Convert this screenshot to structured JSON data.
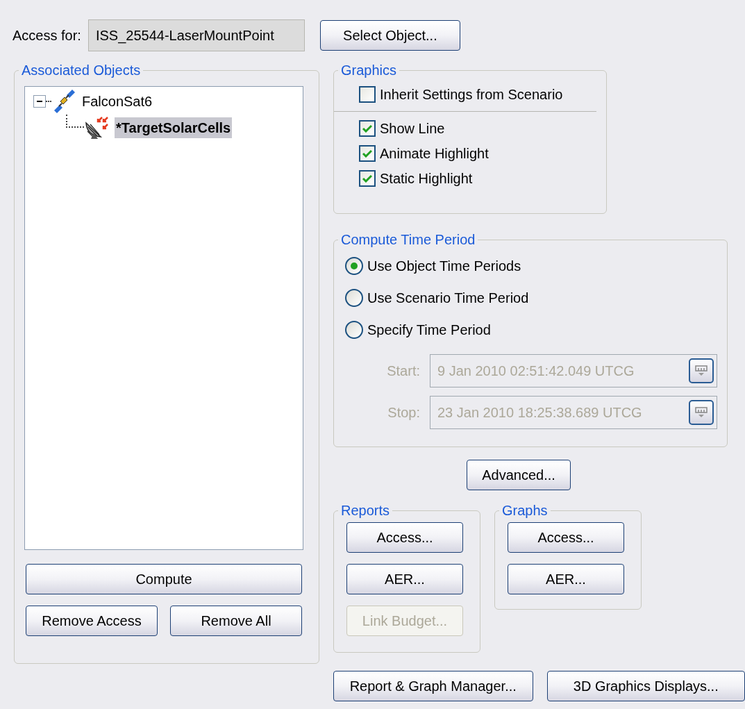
{
  "access_for": {
    "label": "Access for:",
    "value": "ISS_25544-LaserMountPoint"
  },
  "select_object_button": {
    "label": "Select Object...",
    "disabled": false
  },
  "associated_objects": {
    "title": "Associated Objects",
    "tree": [
      {
        "label": "FalconSat6",
        "kind": "satellite",
        "expanded": true,
        "selected": false,
        "children": [
          {
            "label": "*TargetSolarCells",
            "kind": "target",
            "selected": true
          }
        ]
      }
    ],
    "compute_button": {
      "label": "Compute",
      "disabled": false
    },
    "remove_buttons": [
      {
        "label": "Remove Access",
        "disabled": false
      },
      {
        "label": "Remove All",
        "disabled": false
      }
    ]
  },
  "graphics": {
    "title": "Graphics",
    "inherit": {
      "label": "Inherit Settings from Scenario",
      "checked": false
    },
    "options": [
      {
        "label": "Show Line",
        "checked": true
      },
      {
        "label": "Animate Highlight",
        "checked": true
      },
      {
        "label": "Static Highlight",
        "checked": true
      }
    ]
  },
  "compute_time_period": {
    "title": "Compute Time Period",
    "options": [
      {
        "label": "Use Object Time Periods",
        "selected": true
      },
      {
        "label": "Use Scenario Time Period",
        "selected": false
      },
      {
        "label": "Specify Time Period",
        "selected": false
      }
    ],
    "fields": [
      {
        "label": "Start:",
        "value": "9 Jan 2010 02:51:42.049 UTCG",
        "disabled": true
      },
      {
        "label": "Stop:",
        "value": "23 Jan 2010 18:25:38.689 UTCG",
        "disabled": true
      }
    ]
  },
  "advanced_button": {
    "label": "Advanced...",
    "disabled": false
  },
  "reports": {
    "title": "Reports",
    "buttons": [
      {
        "label": "Access...",
        "disabled": false
      },
      {
        "label": "AER...",
        "disabled": false
      },
      {
        "label": "Link Budget...",
        "disabled": true
      }
    ]
  },
  "graphs": {
    "title": "Graphs",
    "buttons": [
      {
        "label": "Access...",
        "disabled": false
      },
      {
        "label": "AER...",
        "disabled": false
      }
    ]
  },
  "bottom_buttons": [
    {
      "label": "Report & Graph Manager...",
      "disabled": false
    },
    {
      "label": "3D Graphics Displays...",
      "disabled": false
    }
  ]
}
